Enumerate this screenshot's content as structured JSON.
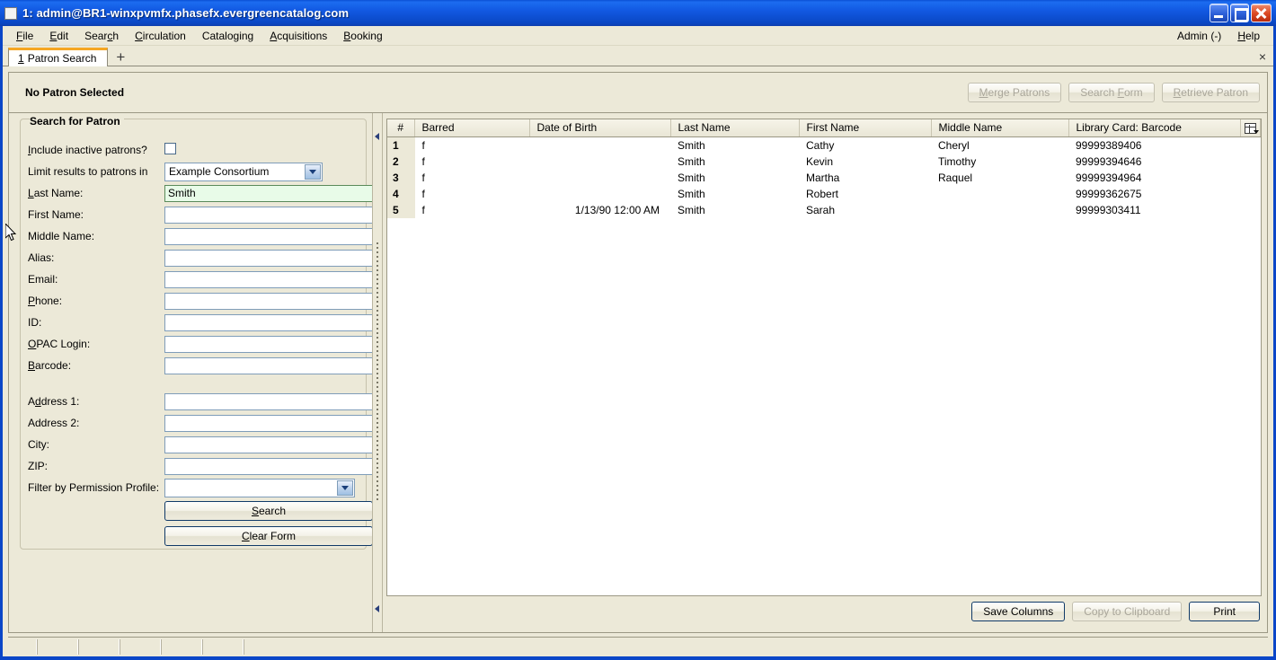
{
  "window": {
    "title": "1: admin@BR1-winxpvmfx.phasefx.evergreencatalog.com",
    "minimize_label": "",
    "maximize_label": "",
    "close_label": ""
  },
  "menubar": {
    "items": [
      {
        "label": "File",
        "accel": "F"
      },
      {
        "label": "Edit",
        "accel": "E"
      },
      {
        "label": "Search",
        "accel": "c"
      },
      {
        "label": "Circulation",
        "accel": "C"
      },
      {
        "label": "Cataloging",
        "accel": "g"
      },
      {
        "label": "Acquisitions",
        "accel": "A"
      },
      {
        "label": "Booking",
        "accel": "B"
      }
    ],
    "right_items": [
      {
        "label": "Admin (-)",
        "accel": ""
      },
      {
        "label": "Help",
        "accel": "H"
      }
    ]
  },
  "tabs": {
    "active": {
      "number": "1",
      "label": "Patron Search"
    },
    "add_label": "+",
    "close_label": "×"
  },
  "patron_header": {
    "title": "No Patron Selected",
    "buttons": [
      {
        "label": "Merge Patrons",
        "disabled": true
      },
      {
        "label": "Search Form",
        "disabled": true
      },
      {
        "label": "Retrieve Patron",
        "disabled": true
      }
    ]
  },
  "search_form": {
    "group_title": "Search for Patron",
    "include_inactive_label": "Include inactive patrons?",
    "include_inactive_checked": false,
    "limit_label": "Limit results to patrons in",
    "limit_value": "Example Consortium",
    "fields": [
      {
        "label": "Last Name:",
        "value": "Smith",
        "focused": true
      },
      {
        "label": "First Name:",
        "value": "",
        "focused": false
      },
      {
        "label": "Middle Name:",
        "value": "",
        "focused": false
      },
      {
        "label": "Alias:",
        "value": "",
        "focused": false
      },
      {
        "label": "Email:",
        "value": "",
        "focused": false
      },
      {
        "label": "Phone:",
        "value": "",
        "focused": false
      },
      {
        "label": "ID:",
        "value": "",
        "focused": false
      },
      {
        "label": "OPAC Login:",
        "value": "",
        "focused": false
      },
      {
        "label": "Barcode:",
        "value": "",
        "focused": false
      }
    ],
    "address_fields": [
      {
        "label": "Address 1:",
        "value": ""
      },
      {
        "label": "Address 2:",
        "value": ""
      },
      {
        "label": "City:",
        "value": ""
      },
      {
        "label": "ZIP:",
        "value": ""
      }
    ],
    "permission_label": "Filter by Permission Profile:",
    "permission_value": "",
    "search_button": "Search",
    "clear_button": "Clear Form"
  },
  "results": {
    "columns": [
      "#",
      "Barred",
      "Date of Birth",
      "Last Name",
      "First Name",
      "Middle Name",
      "Library Card: Barcode"
    ],
    "rows": [
      {
        "num": "1",
        "barred": "f",
        "dob": "",
        "last": "Smith",
        "first": "Cathy",
        "middle": "Cheryl",
        "barcode": "99999389406"
      },
      {
        "num": "2",
        "barred": "f",
        "dob": "",
        "last": "Smith",
        "first": "Kevin",
        "middle": "Timothy",
        "barcode": "99999394646"
      },
      {
        "num": "3",
        "barred": "f",
        "dob": "",
        "last": "Smith",
        "first": "Martha",
        "middle": "Raquel",
        "barcode": "99999394964"
      },
      {
        "num": "4",
        "barred": "f",
        "dob": "",
        "last": "Smith",
        "first": "Robert",
        "middle": "",
        "barcode": "99999362675"
      },
      {
        "num": "5",
        "barred": "f",
        "dob": "1/13/90 12:00 AM",
        "last": "Smith",
        "first": "Sarah",
        "middle": "",
        "barcode": "99999303411"
      }
    ],
    "footer_buttons": [
      {
        "label": "Save Columns",
        "disabled": false
      },
      {
        "label": "Copy to Clipboard",
        "disabled": true
      },
      {
        "label": "Print",
        "disabled": false
      }
    ]
  },
  "colors": {
    "titlebar_blue": "#1259e2",
    "window_border": "#0a46c8",
    "chrome": "#ece9d8",
    "tab_accent": "#f5a623",
    "focused_field": "#e8fbe8",
    "default_button_border": "#103a68"
  }
}
